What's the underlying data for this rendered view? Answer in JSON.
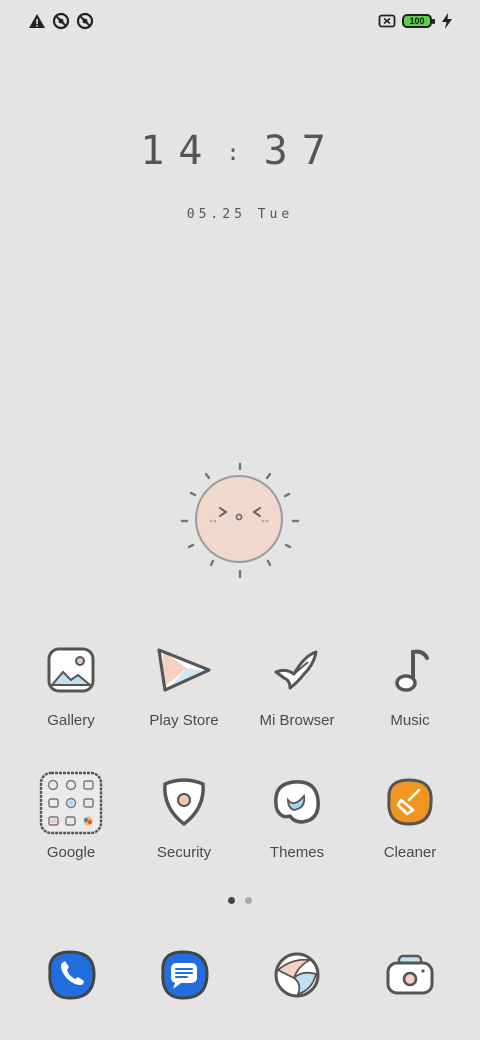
{
  "status_bar": {
    "left_icons": [
      "warning-icon",
      "no-sync-icon",
      "no-sync-icon"
    ],
    "right_icons": [
      "sim-off-icon",
      "battery-icon",
      "charging-icon"
    ],
    "battery_level": "100"
  },
  "clock": {
    "hour": "14",
    "minute": "37",
    "separator": ":"
  },
  "date": {
    "text": "05.25 Tue"
  },
  "apps_row1": [
    {
      "label": "Gallery",
      "icon": "gallery-icon"
    },
    {
      "label": "Play Store",
      "icon": "play-store-icon"
    },
    {
      "label": "Mi Browser",
      "icon": "mi-browser-icon"
    },
    {
      "label": "Music",
      "icon": "music-icon"
    }
  ],
  "apps_row2": [
    {
      "label": "Google",
      "icon": "google-folder-icon"
    },
    {
      "label": "Security",
      "icon": "security-icon"
    },
    {
      "label": "Themes",
      "icon": "themes-icon"
    },
    {
      "label": "Cleaner",
      "icon": "cleaner-icon"
    }
  ],
  "page_indicator": {
    "pages": 2,
    "current": 1
  },
  "dock": [
    {
      "icon": "phone-icon"
    },
    {
      "icon": "messages-icon"
    },
    {
      "icon": "mi-browser-dock-icon"
    },
    {
      "icon": "camera-icon"
    }
  ],
  "colors": {
    "background": "#e4e4e4",
    "battery": "#5ad14a",
    "phone_blue": "#1f6fe0",
    "cleaner_orange": "#ef9520",
    "sun_fill": "#f0d8cc"
  }
}
